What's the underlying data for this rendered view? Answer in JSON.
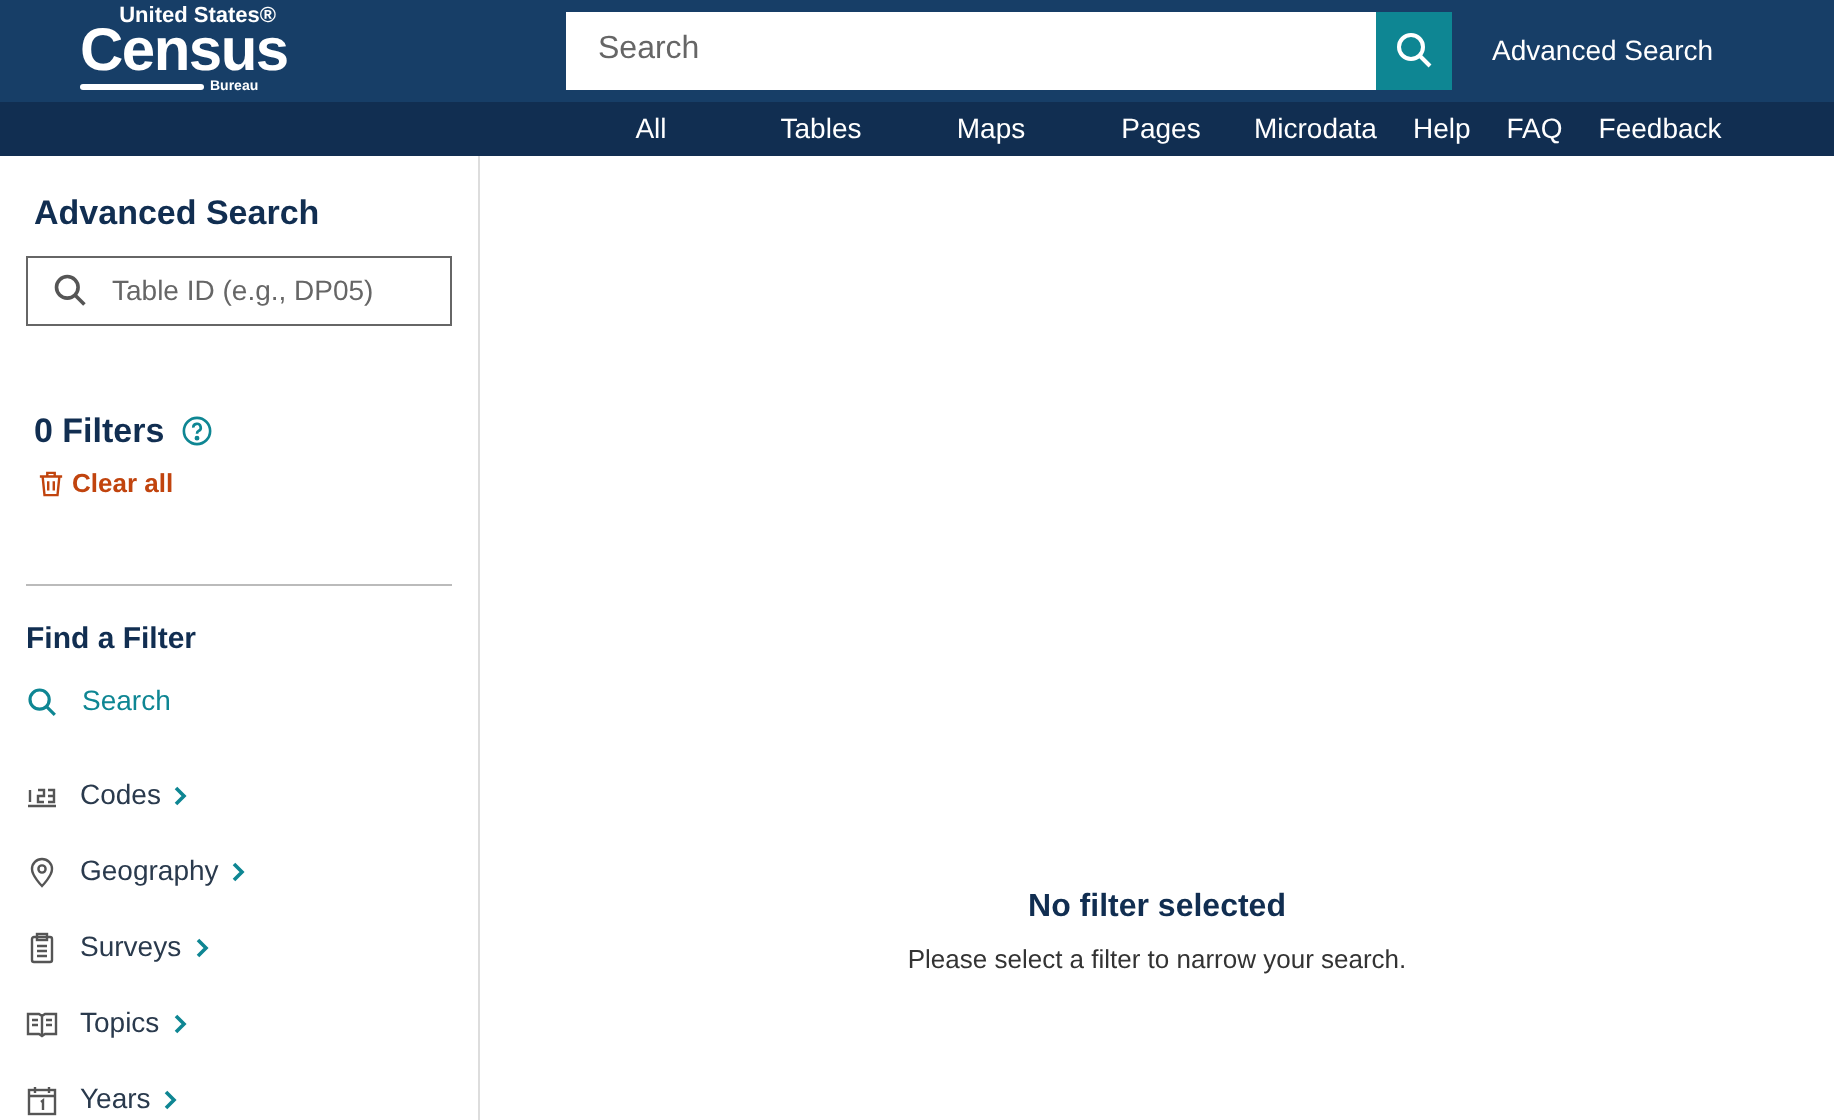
{
  "logo": {
    "top": "United States®",
    "main": "Census",
    "bottom": "Bureau"
  },
  "header_search": {
    "placeholder": "Search"
  },
  "advanced_search_link": "Advanced Search",
  "nav": [
    {
      "label": "All",
      "kind": "wide"
    },
    {
      "label": "Tables",
      "kind": "wide"
    },
    {
      "label": "Maps",
      "kind": "wide"
    },
    {
      "label": "Pages",
      "kind": "wide"
    },
    {
      "label": "Microdata",
      "kind": "tight"
    },
    {
      "label": "Help",
      "kind": "tight"
    },
    {
      "label": "FAQ",
      "kind": "tight"
    },
    {
      "label": "Feedback",
      "kind": "tight"
    }
  ],
  "sidebar": {
    "title": "Advanced Search",
    "table_search": {
      "placeholder": "Table ID (e.g., DP05)"
    },
    "filters_count": "0 Filters",
    "clear_all": "Clear all",
    "find_title": "Find a Filter",
    "find_search": "Search",
    "items": [
      {
        "label": "Codes",
        "kind": "codes"
      },
      {
        "label": "Geography",
        "kind": "geography"
      },
      {
        "label": "Surveys",
        "kind": "surveys"
      },
      {
        "label": "Topics",
        "kind": "topics"
      },
      {
        "label": "Years",
        "kind": "years"
      }
    ]
  },
  "main": {
    "title": "No filter selected",
    "message": "Please select a filter to narrow your search."
  }
}
